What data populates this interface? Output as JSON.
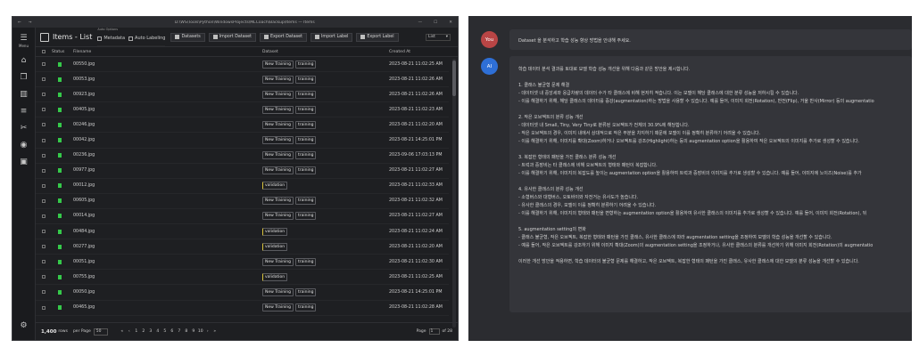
{
  "left_window": {
    "titlebar": {
      "path": "D:\\WS\\Tools\\Python\\WindowsProjects\\MLCoach\\Backup\\Items — Items",
      "minimize": "—",
      "maximize": "☐",
      "close": "✕"
    },
    "sidebar": {
      "menu_label": "Menu"
    },
    "toolbar": {
      "title": "Items - List",
      "options_caption": "Auto Options",
      "metadata_label": "Metadata",
      "auto_labeling_label": "Auto Labeling",
      "datasets_label": "Datasets",
      "import_dataset_label": "Import Dataset",
      "export_dataset_label": "Export Dataset",
      "import_label_label": "Import Label",
      "export_label_label": "Export Label",
      "view_select": "List"
    },
    "table": {
      "headers": {
        "status": "Status",
        "filename": "Filename",
        "dataset": "Dataset",
        "created": "Created At"
      },
      "rows": [
        {
          "filename": "00550.jpg",
          "tags": [
            "New Training",
            "training"
          ],
          "created": "2023-08-21 11:02:25 AM"
        },
        {
          "filename": "00053.jpg",
          "tags": [
            "New Training",
            "training"
          ],
          "created": "2023-08-21 11:02:26 AM"
        },
        {
          "filename": "00923.jpg",
          "tags": [
            "New Training",
            "training"
          ],
          "created": "2023-08-21 11:02:26 AM"
        },
        {
          "filename": "00405.jpg",
          "tags": [
            "New Training",
            "training"
          ],
          "created": "2023-08-21 11:02:23 AM"
        },
        {
          "filename": "00246.jpg",
          "tags": [
            "New Training",
            "training"
          ],
          "created": "2023-08-21 11:02:20 AM"
        },
        {
          "filename": "00042.jpg",
          "tags": [
            "New Training",
            "training"
          ],
          "created": "2023-08-21 14:25:01 PM"
        },
        {
          "filename": "00236.jpg",
          "tags": [
            "New Training",
            "training"
          ],
          "created": "2023-09-06 17:03:13 PM"
        },
        {
          "filename": "00977.jpg",
          "tags": [
            "New Training",
            "training"
          ],
          "created": "2023-08-21 11:02:27 AM"
        },
        {
          "filename": "00012.jpg",
          "tags": [
            "validation"
          ],
          "created": "2023-08-21 11:02:33 AM"
        },
        {
          "filename": "00605.jpg",
          "tags": [
            "New Training",
            "training"
          ],
          "created": "2023-08-21 11:02:32 AM"
        },
        {
          "filename": "00014.jpg",
          "tags": [
            "New Training",
            "training"
          ],
          "created": "2023-08-21 11:02:27 AM"
        },
        {
          "filename": "00484.jpg",
          "tags": [
            "validation"
          ],
          "created": "2023-08-21 11:02:24 AM"
        },
        {
          "filename": "00277.jpg",
          "tags": [
            "validation"
          ],
          "created": "2023-08-21 11:02:20 AM"
        },
        {
          "filename": "00051.jpg",
          "tags": [
            "New Training",
            "training"
          ],
          "created": "2023-08-21 11:02:30 AM"
        },
        {
          "filename": "00755.jpg",
          "tags": [
            "validation"
          ],
          "created": "2023-08-21 11:02:25 AM"
        },
        {
          "filename": "00050.jpg",
          "tags": [
            "New Training",
            "training"
          ],
          "created": "2023-08-21 14:25:01 PM"
        },
        {
          "filename": "00465.jpg",
          "tags": [
            "New Training",
            "training"
          ],
          "created": "2023-08-21 11:02:28 AM"
        }
      ]
    },
    "footer": {
      "count": "1,400",
      "rows_label": "rows",
      "per_page_label": "per Page",
      "per_page_value": "50",
      "pager": [
        "«",
        "‹",
        "1",
        "2",
        "3",
        "4",
        "5",
        "6",
        "7",
        "8",
        "9",
        "10",
        "›",
        "»"
      ],
      "page_label": "Page",
      "page_value": "1",
      "page_total": "of 28"
    }
  },
  "right_window": {
    "user": {
      "avatar": "You",
      "text": "Dataset 을 분석하고 학습 성능 향상 방법을 안내해 주세요."
    },
    "ai": {
      "avatar": "AI",
      "lines": [
        "학습 데이터 분석 결과를 토대로 모델 학습 성능 개선을 위해 다음과 같은 방안을 제시합니다.",
        "",
        "1. 클래스 불균형 문제 해결",
        "- 데이터셋 내 중앙세와 응급차량의 데이터 수가 타 클래스에 비해 현저히 적습니다. 이는 모델이 해당 클래스에 대한 분류 성능을 저하시킬 수 있습니다.",
        "- 이를 해결하기 위해, 해당 클래스의 데이터를 증강(augmentation)하는 방법을 사용할 수 있습니다. 예를 들어, 이미지 회전(Rotation), 반전(Flip), 거울 반사(Mirror) 등의 augmentatio",
        "",
        "2. 작은 오브젝트의 분류 성능 개선",
        "- 데이터셋 내 Small, Tiny, Very Tiny로 분류된 오브젝트가 전체의 30.9%에 해당합니다.",
        "- 작은 오브젝트의 경우, 이미지 내에서 상대적으로 작은 부분을 차지하기 때문에 모델이 이를 정확히 분류하기 어려울 수 있습니다.",
        "- 이를 해결하기 위해, 이미지를 확대(Zoom)하거나 오브젝트를 강조(Highlight)하는 등의 augmentation option을 활용하여 작은 오브젝트의 이미지를 추가로 생성할 수 있습니다.",
        "",
        "3. 복잡한 형태의 패턴을 가진 클래스 분류 성능 개선",
        "- 트럭과 중장비는 타 클래스에 비해 오브젝트의 형태와 패턴이 복잡합니다.",
        "- 이를 해결하기 위해, 이미지의 복잡도를 높이는 augmentation option을 활용하여 트럭과 중장비의 이미지를 추가로 생성할 수 있습니다. 예를 들어, 이미지에 노이즈(Noise)를 추가",
        "",
        "4. 유사한 클래스의 분류 성능 개선",
        "- 소형버스와 대형버스, 오토바이와 자전거는 유사도가 높습니다.",
        "- 유사한 클래스의 경우, 모델이 이를 정확히 분류하기 어려울 수 있습니다.",
        "- 이를 해결하기 위해, 이미지의 형태와 패턴을 변형하는 augmentation option을 활용하여 유사한 클래스의 이미지를 추가로 생성할 수 있습니다. 예를 들어, 이미지 회전(Rotation), 뒤",
        "",
        "5. augmentation setting의 변화",
        "- 클래스 불균형, 작은 오브젝트, 복잡한 형태와 패턴을 가진 클래스, 유사한 클래스에 따라 augmentation setting을 조정하여 모델의 학습 성능을 개선할 수 있습니다.",
        "- 예를 들어, 작은 오브젝트를 강조하기 위해 이미지 확대(Zoom)의 augmentation setting을 조정하거나, 유사한 클래스의 분류를 개선하기 위해 이미지 회전(Rotation)의 augmentatio",
        "",
        "이러한 개선 방안을 적용하면, 학습 데이터의 불균형 문제를 해결하고, 작은 오브젝트, 복잡한 형태의 패턴을 가진 클래스, 유사한 클래스에 대한 모델의 분류 성능을 개선할 수 있습니다."
      ]
    }
  },
  "colors": {
    "status_flag": "#35c94a",
    "validation_accent": "#d8c23a",
    "you_avatar": "#b94545",
    "ai_avatar": "#2e6fd6"
  }
}
